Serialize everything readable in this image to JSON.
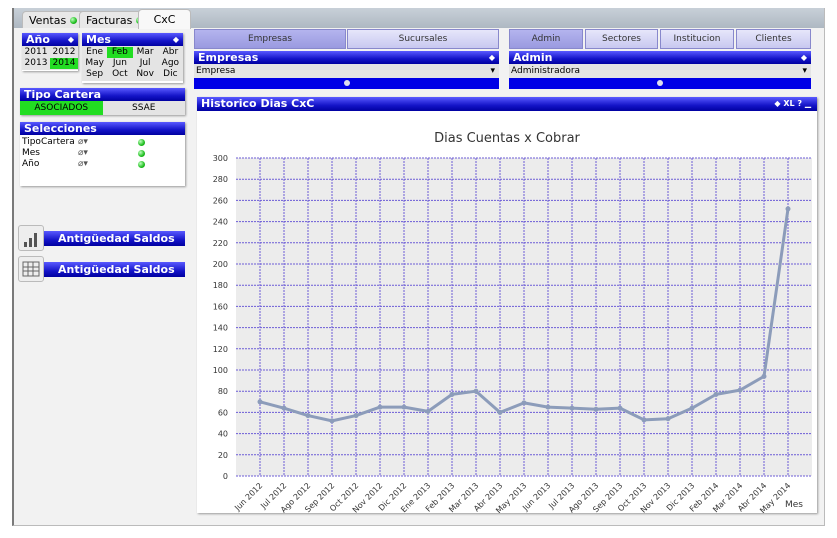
{
  "tabs": [
    {
      "label": "Ventas",
      "dot": true
    },
    {
      "label": "Facturas",
      "dot": true
    },
    {
      "label": "CxC",
      "active": true
    }
  ],
  "year": {
    "title": "Año",
    "items": [
      "2011",
      "2012",
      "2013",
      "2014"
    ],
    "selected": "2014"
  },
  "month": {
    "title": "Mes",
    "items": [
      "Ene",
      "Feb",
      "Mar",
      "Abr",
      "May",
      "Jun",
      "Jul",
      "Ago",
      "Sep",
      "Oct",
      "Nov",
      "Dic"
    ],
    "selected": "Feb"
  },
  "tipo": {
    "title": "Tipo Cartera",
    "items": [
      "ASOCIADOS",
      "SSAE"
    ],
    "selected": "ASOCIADOS"
  },
  "selecciones": {
    "title": "Selecciones",
    "rows": [
      "TipoCartera",
      "Mes",
      "Año"
    ]
  },
  "nav": [
    {
      "label": "Antigüedad Saldos",
      "icon": "bar-chart-icon"
    },
    {
      "label": "Antigüedad Saldos",
      "icon": "table-icon"
    }
  ],
  "left_buttons": [
    {
      "label": "Empresas",
      "active": true
    },
    {
      "label": "Sucursales"
    }
  ],
  "right_buttons": [
    {
      "label": "Admin",
      "active": true
    },
    {
      "label": "Sectores"
    },
    {
      "label": "Institucion"
    },
    {
      "label": "Clientes"
    }
  ],
  "empresas": {
    "title": "Empresas",
    "field": "Empresa"
  },
  "admin": {
    "title": "Admin",
    "field": "Administradora"
  },
  "chart_box": {
    "title": "Historico Dias CxC",
    "xl": "XL",
    "help": "?"
  },
  "chart_data": {
    "type": "line",
    "title": "Dias Cuentas x Cobrar",
    "xlabel": "Mes",
    "ylabel": "",
    "ylim": [
      0,
      300
    ],
    "yticks": [
      0,
      20,
      40,
      60,
      80,
      100,
      120,
      140,
      160,
      180,
      200,
      220,
      240,
      260,
      280,
      300
    ],
    "grid": true,
    "categories": [
      "Jun 2012",
      "Jul 2012",
      "Ago 2012",
      "Sep 2012",
      "Oct 2012",
      "Nov 2012",
      "Dic 2012",
      "Ene 2013",
      "Feb 2013",
      "Mar 2013",
      "Abr 2013",
      "May 2013",
      "Jun 2013",
      "Jul 2013",
      "Ago 2013",
      "Sep 2013",
      "Oct 2013",
      "Nov 2013",
      "Dic 2013",
      "Feb 2014",
      "Mar 2014",
      "Abr 2014",
      "May 2014"
    ],
    "values": [
      70,
      64,
      57,
      52,
      57,
      65,
      65,
      61,
      77,
      80,
      60,
      69,
      65,
      64,
      63,
      64,
      53,
      54,
      64,
      77,
      81,
      94,
      252
    ],
    "color": "#8c9cba"
  }
}
